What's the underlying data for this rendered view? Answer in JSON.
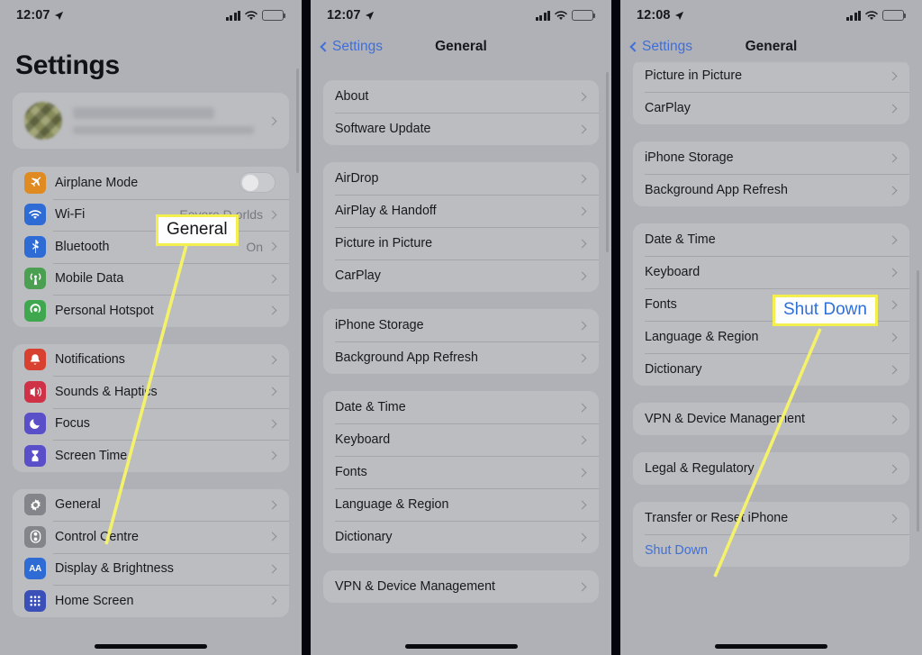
{
  "meta": {
    "device": "iPhone",
    "colors": {
      "panel_bg": "#b0b1b6",
      "row_bg": "#bcbdc1",
      "link_blue": "#3f6fd8",
      "callout_border": "#f2ef4f",
      "leader_line": "#f4f16a",
      "divider_black": "#05060d"
    }
  },
  "panel1": {
    "status": {
      "time": "12:07",
      "location_arrow": "➤",
      "signal": "4 bars",
      "wifi": "wifi-full",
      "battery": "low"
    },
    "page_title": "Settings",
    "account": {
      "name_redacted": true,
      "subtitle_redacted": true,
      "chevron": "›"
    },
    "groups": [
      {
        "id": "connectivity",
        "rows": [
          {
            "icon": "airplane-icon",
            "icon_color": "#e08a22",
            "label": "Airplane Mode",
            "control": "toggle",
            "toggle_on": false
          },
          {
            "icon": "wifi-icon",
            "icon_color": "#2f6bd4",
            "label": "Wi-Fi",
            "value": "Eeyore D     orlds",
            "chevron": "›"
          },
          {
            "icon": "bluetooth-icon",
            "icon_color": "#2f6bd4",
            "label": "Bluetooth",
            "value": "On",
            "chevron": "›"
          },
          {
            "icon": "cellular-icon",
            "icon_color": "#4aa050",
            "label": "Mobile Data",
            "value": "",
            "chevron": "›"
          },
          {
            "icon": "hotspot-icon",
            "icon_color": "#3fa84f",
            "label": "Personal Hotspot",
            "value": "",
            "chevron": "›"
          }
        ]
      },
      {
        "id": "alerts",
        "rows": [
          {
            "icon": "bell-icon",
            "icon_color": "#d8402f",
            "label": "Notifications",
            "value": "",
            "chevron": "›"
          },
          {
            "icon": "speaker-icon",
            "icon_color": "#cf3246",
            "label": "Sounds & Haptics",
            "value": "",
            "chevron": "›"
          },
          {
            "icon": "moon-icon",
            "icon_color": "#5a4ec9",
            "label": "Focus",
            "value": "",
            "chevron": "›"
          },
          {
            "icon": "hourglass-icon",
            "icon_color": "#5a4ec9",
            "label": "Screen Time",
            "value": "",
            "chevron": "›"
          }
        ]
      },
      {
        "id": "system",
        "rows": [
          {
            "icon": "gear-icon",
            "icon_color": "#84858b",
            "label": "General",
            "value": "",
            "chevron": "›"
          },
          {
            "icon": "control-centre-icon",
            "icon_color": "#84858b",
            "label": "Control Centre",
            "value": "",
            "chevron": "›"
          },
          {
            "icon": "display-brightness-icon",
            "icon_color": "#2f6bd4",
            "label": "Display & Brightness",
            "value": "",
            "chevron": "›"
          },
          {
            "icon": "home-screen-icon",
            "icon_color": "#3a50b8",
            "label": "Home Screen",
            "value": "",
            "chevron": "›"
          }
        ]
      }
    ],
    "callout": {
      "text": "General",
      "style": "black"
    }
  },
  "panel2": {
    "status": {
      "time": "12:07"
    },
    "nav": {
      "back_label": "Settings",
      "title": "General"
    },
    "groups": [
      {
        "id": "g1",
        "rows": [
          {
            "label": "About",
            "chevron": "›"
          },
          {
            "label": "Software Update",
            "chevron": "›"
          }
        ]
      },
      {
        "id": "g2",
        "rows": [
          {
            "label": "AirDrop",
            "chevron": "›"
          },
          {
            "label": "AirPlay & Handoff",
            "chevron": "›"
          },
          {
            "label": "Picture in Picture",
            "chevron": "›"
          },
          {
            "label": "CarPlay",
            "chevron": "›"
          }
        ]
      },
      {
        "id": "g3",
        "rows": [
          {
            "label": "iPhone Storage",
            "chevron": "›"
          },
          {
            "label": "Background App Refresh",
            "chevron": "›"
          }
        ]
      },
      {
        "id": "g4",
        "rows": [
          {
            "label": "Date & Time",
            "chevron": "›"
          },
          {
            "label": "Keyboard",
            "chevron": "›"
          },
          {
            "label": "Fonts",
            "chevron": "›"
          },
          {
            "label": "Language & Region",
            "chevron": "›"
          },
          {
            "label": "Dictionary",
            "chevron": "›"
          }
        ]
      },
      {
        "id": "g5",
        "rows": [
          {
            "label": "VPN & Device Management",
            "chevron": "›"
          }
        ]
      }
    ]
  },
  "panel3": {
    "status": {
      "time": "12:08"
    },
    "nav": {
      "back_label": "Settings",
      "title": "General"
    },
    "groups": [
      {
        "id": "g2",
        "rows": [
          {
            "label": "Picture in Picture",
            "chevron": "›"
          },
          {
            "label": "CarPlay",
            "chevron": "›"
          }
        ]
      },
      {
        "id": "g3",
        "rows": [
          {
            "label": "iPhone Storage",
            "chevron": "›"
          },
          {
            "label": "Background App Refresh",
            "chevron": "›"
          }
        ]
      },
      {
        "id": "g4",
        "rows": [
          {
            "label": "Date & Time",
            "chevron": "›"
          },
          {
            "label": "Keyboard",
            "chevron": "›"
          },
          {
            "label": "Fonts",
            "chevron": "›"
          },
          {
            "label": "Language & Region",
            "chevron": "›"
          },
          {
            "label": "Dictionary",
            "chevron": "›"
          }
        ]
      },
      {
        "id": "g5",
        "rows": [
          {
            "label": "VPN & Device Management",
            "chevron": "›"
          }
        ]
      },
      {
        "id": "g6",
        "rows": [
          {
            "label": "Legal & Regulatory",
            "chevron": "›"
          }
        ]
      },
      {
        "id": "g7",
        "rows": [
          {
            "label": "Transfer or Reset iPhone",
            "chevron": "›"
          },
          {
            "label": "Shut Down",
            "link": true
          }
        ]
      }
    ],
    "callout": {
      "text": "Shut Down",
      "style": "blue"
    }
  }
}
